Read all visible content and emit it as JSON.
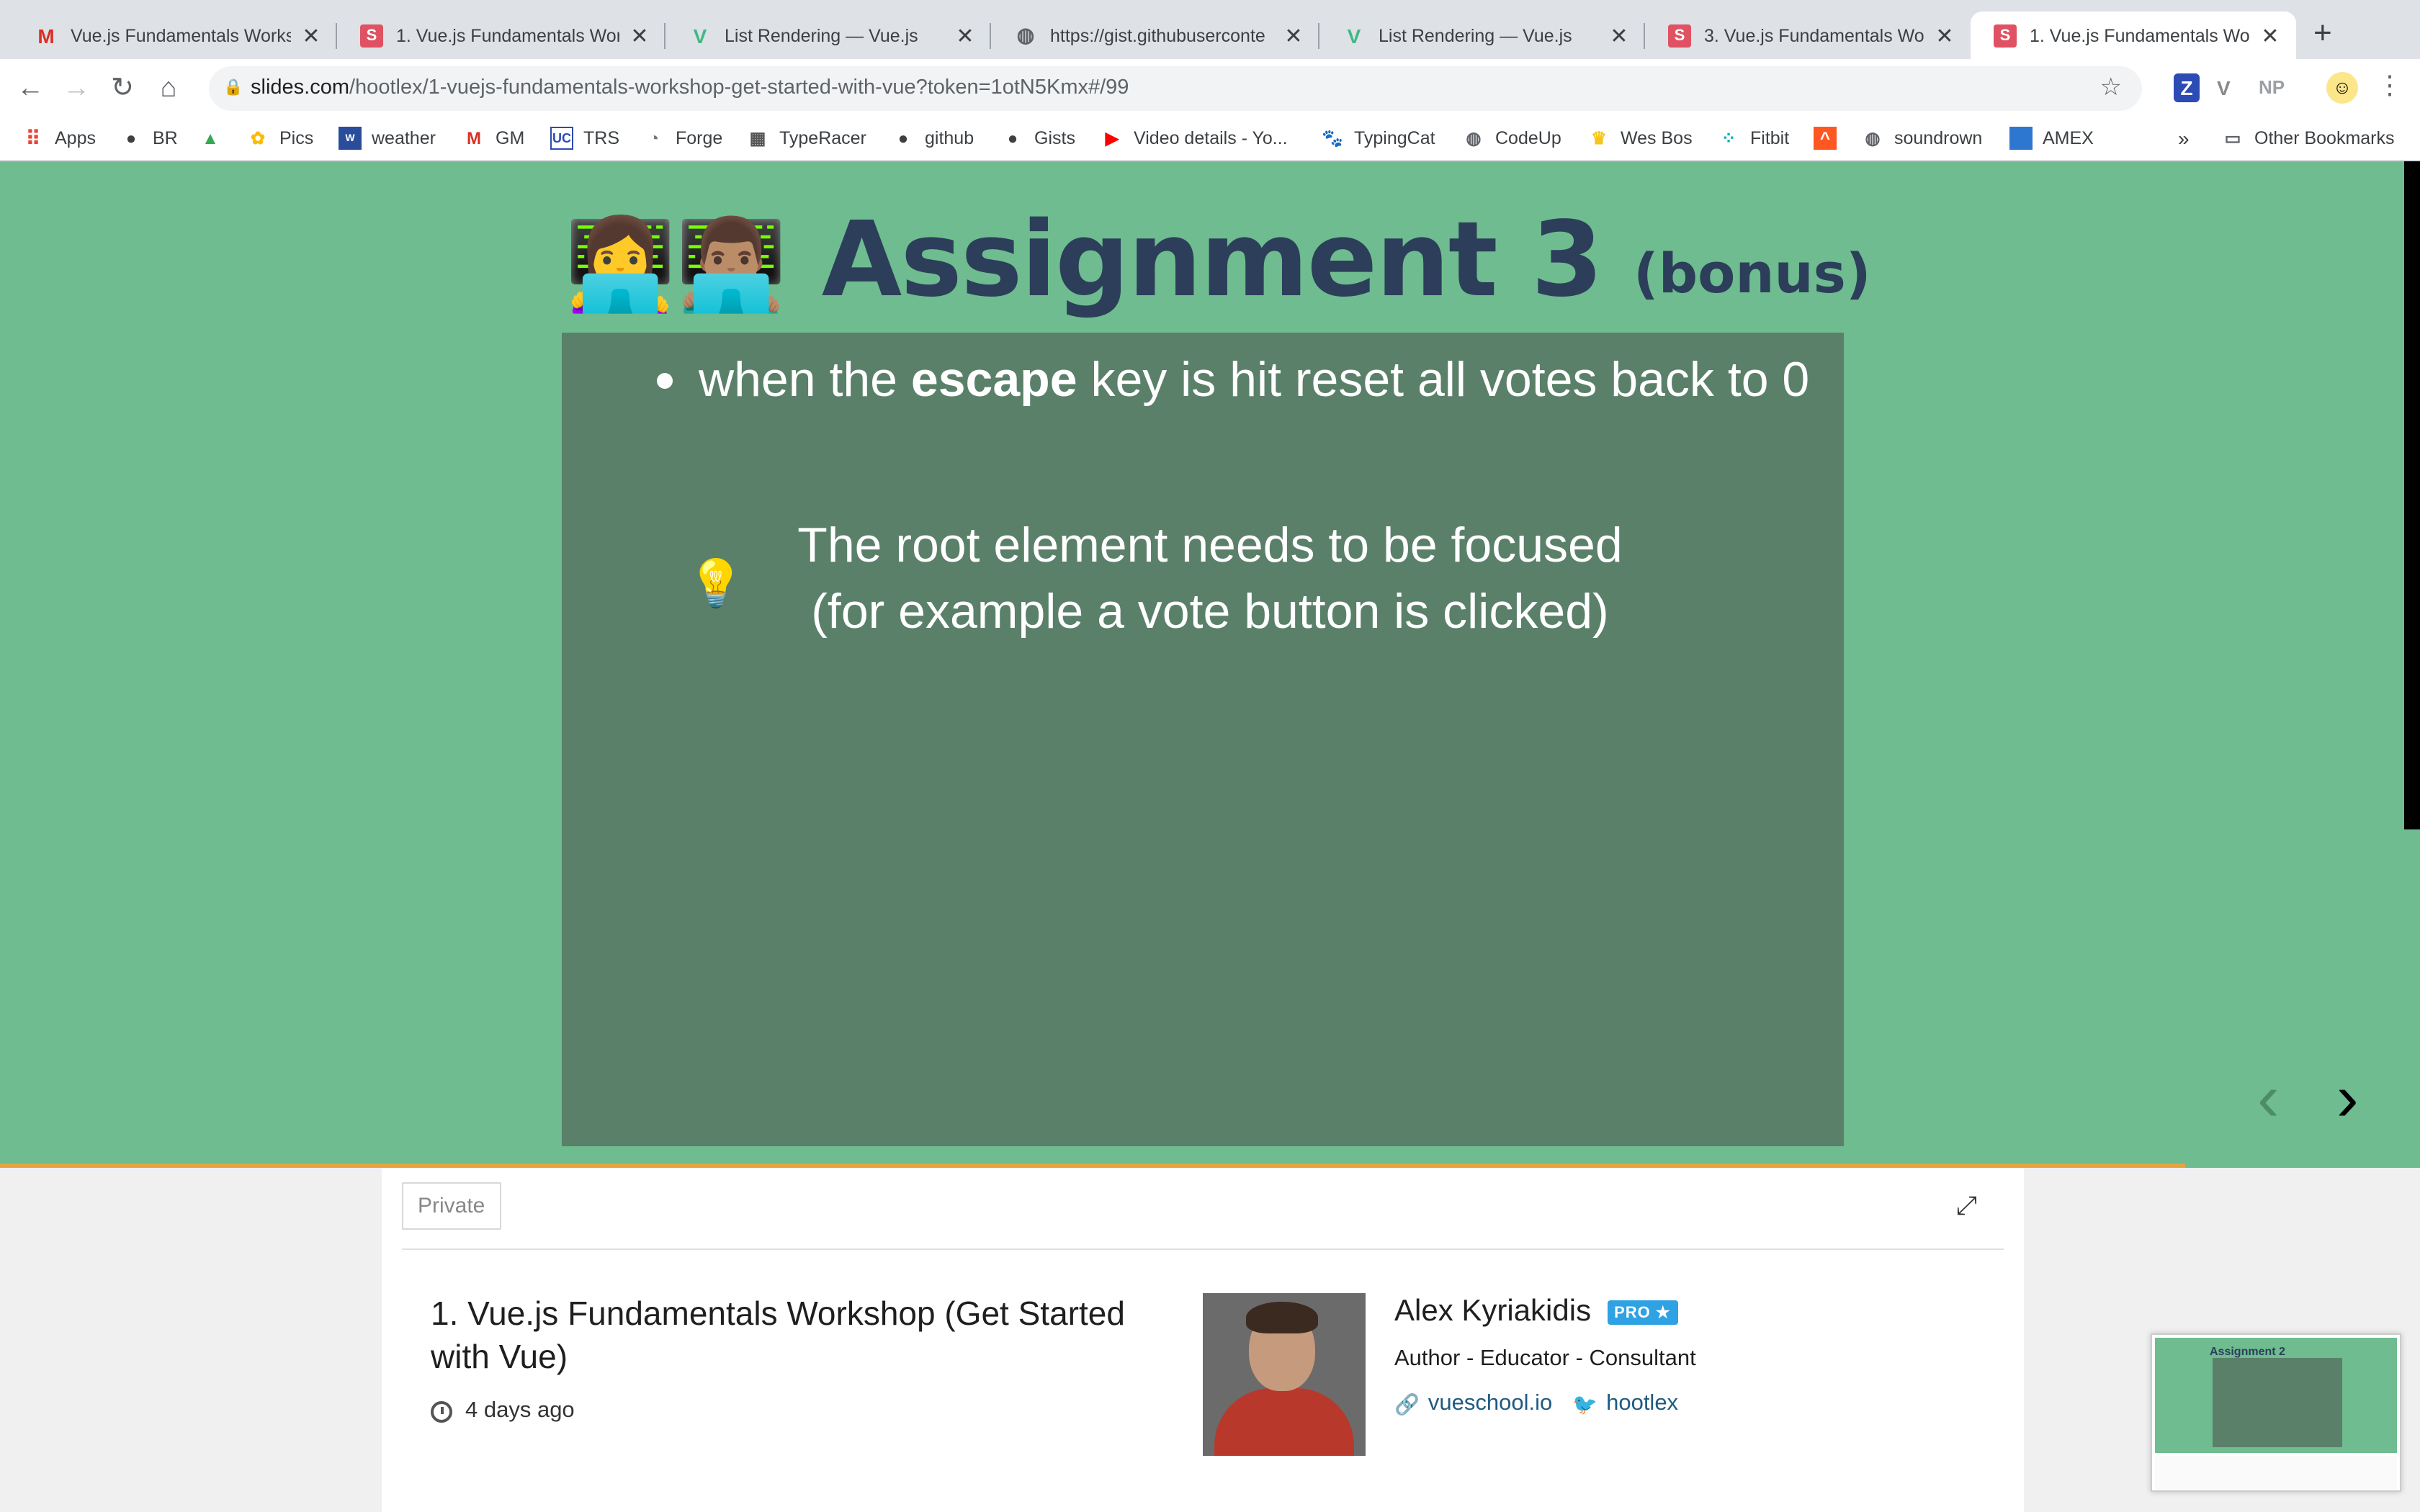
{
  "tabs": [
    {
      "label": "Vue.js Fundamentals Worksh",
      "icon": "gmail-icon",
      "active": false
    },
    {
      "label": "1. Vue.js Fundamentals Work",
      "icon": "slides-icon",
      "active": false
    },
    {
      "label": "List Rendering — Vue.js",
      "icon": "vue-icon",
      "active": false
    },
    {
      "label": "https://gist.githubuserconte",
      "icon": "globe-icon",
      "active": false
    },
    {
      "label": "List Rendering — Vue.js",
      "icon": "vue-icon",
      "active": false
    },
    {
      "label": "3. Vue.js Fundamentals Work",
      "icon": "slides-icon",
      "active": false
    },
    {
      "label": "1. Vue.js Fundamentals Work",
      "icon": "slides-icon",
      "active": true
    }
  ],
  "toolbar": {
    "url_host": "slides.com",
    "url_path": "/hootlex/1-vuejs-fundamentals-workshop-get-started-with-vue?token=1otN5Kmx#/99",
    "extensions": [
      "Z",
      "V",
      "NP"
    ]
  },
  "bookmarks": [
    {
      "label": "Apps",
      "icon": "apps-grid-icon"
    },
    {
      "label": "BR",
      "icon": "github-icon"
    },
    {
      "label": "",
      "icon": "drive-icon"
    },
    {
      "label": "Pics",
      "icon": "photos-icon"
    },
    {
      "label": "weather",
      "icon": "weather-icon"
    },
    {
      "label": "GM",
      "icon": "gmail-icon"
    },
    {
      "label": "TRS",
      "icon": "trs-icon"
    },
    {
      "label": "Forge",
      "icon": "forge-icon"
    },
    {
      "label": "TypeRacer",
      "icon": "typeracer-icon"
    },
    {
      "label": "github",
      "icon": "github-icon"
    },
    {
      "label": "Gists",
      "icon": "github-icon"
    },
    {
      "label": "Video details - Yo...",
      "icon": "youtube-icon"
    },
    {
      "label": "TypingCat",
      "icon": "paw-icon"
    },
    {
      "label": "CodeUp",
      "icon": "globe-icon"
    },
    {
      "label": "Wes Bos",
      "icon": "crown-icon"
    },
    {
      "label": "Fitbit",
      "icon": "fitbit-icon"
    },
    {
      "label": "",
      "icon": "fire-icon"
    },
    {
      "label": "soundrown",
      "icon": "globe-icon"
    },
    {
      "label": "AMEX",
      "icon": "amex-icon"
    }
  ],
  "bookmarks_overflow": "»",
  "other_bookmarks": "Other Bookmarks",
  "slide": {
    "title": "Assignment 3",
    "title_suffix": "(bonus)",
    "emojis": "👩‍💻👨🏽‍💻",
    "bullet_prefix": "when the ",
    "bullet_bold": "escape",
    "bullet_suffix": " key is hit reset all votes back to 0",
    "tip_line1": "The root element needs to be focused",
    "tip_line2": "(for example a vote button is clicked)",
    "progress": 0.903
  },
  "panel": {
    "visibility": "Private",
    "deck_title": "1. Vue.js Fundamentals Workshop (Get Started with Vue)",
    "updated": "4 days ago",
    "author_name": "Alex Kyriakidis",
    "pro_badge": "PRO ★",
    "author_role": "Author - Educator - Consultant",
    "website": "vueschool.io",
    "twitter": "hootlex"
  },
  "thumbnail": {
    "title": "Assignment 2"
  },
  "colors": {
    "slide_bg": "#6ebc8f",
    "slide_box": "#5a806a",
    "title": "#2c3e5a",
    "progress": "#e8a33d",
    "pro_badge": "#2fa2e4"
  }
}
